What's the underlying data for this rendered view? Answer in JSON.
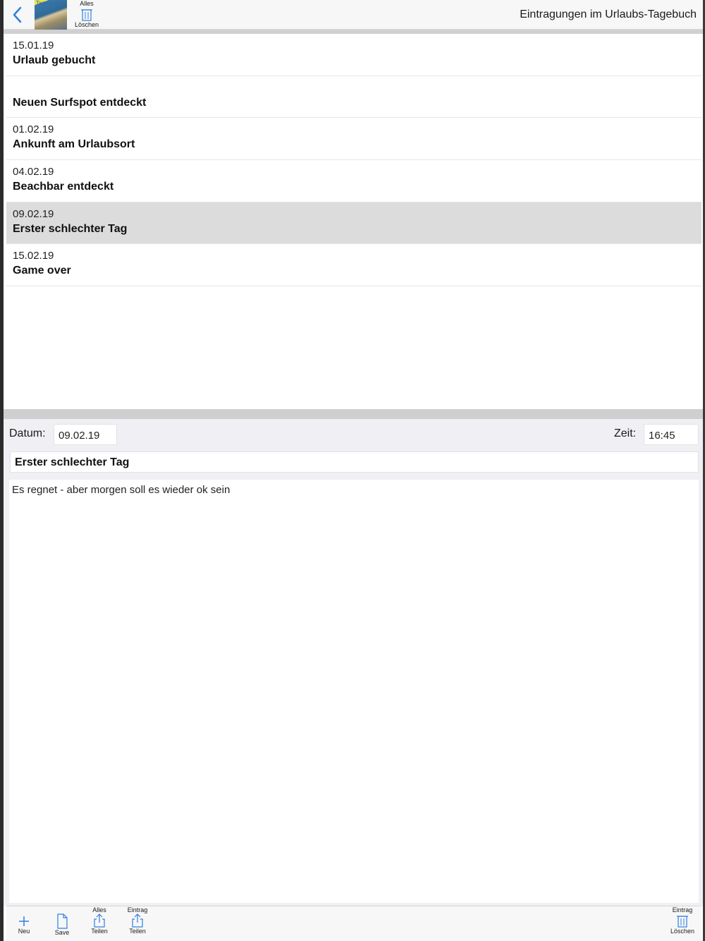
{
  "navbar": {
    "title": "Eintragungen im Urlaubs-Tagebuch",
    "thumb_title": "Tagebuch",
    "delete_all": {
      "top": "Alles",
      "bottom": "Löschen"
    }
  },
  "entries": [
    {
      "date": "15.01.19",
      "title": "Urlaub gebucht",
      "selected": false
    },
    {
      "date": "",
      "title": "Neuen Surfspot entdeckt",
      "selected": false
    },
    {
      "date": "01.02.19",
      "title": "Ankunft am Urlaubsort",
      "selected": false
    },
    {
      "date": "04.02.19",
      "title": "Beachbar entdeckt",
      "selected": false
    },
    {
      "date": "09.02.19",
      "title": "Erster schlechter Tag",
      "selected": true
    },
    {
      "date": "15.02.19",
      "title": "Game over",
      "selected": false
    }
  ],
  "editor": {
    "date_label": "Datum:",
    "date_value": "09.02.19",
    "time_label": "Zeit:",
    "time_value": "16:45",
    "title_value": "Erster schlechter Tag",
    "body_value": "Es regnet - aber morgen soll es wieder ok sein"
  },
  "bottombar": {
    "new_label": "Neu",
    "save_label": "Save",
    "share_all": {
      "top": "Alles",
      "bottom": "Teilen"
    },
    "share_entry": {
      "top": "Eintrag",
      "bottom": "Teilen"
    },
    "delete_entry": {
      "top": "Eintrag",
      "bottom": "Löschen"
    }
  },
  "colors": {
    "accent": "#2f7fe0",
    "selected_row": "#dcdcdc"
  }
}
